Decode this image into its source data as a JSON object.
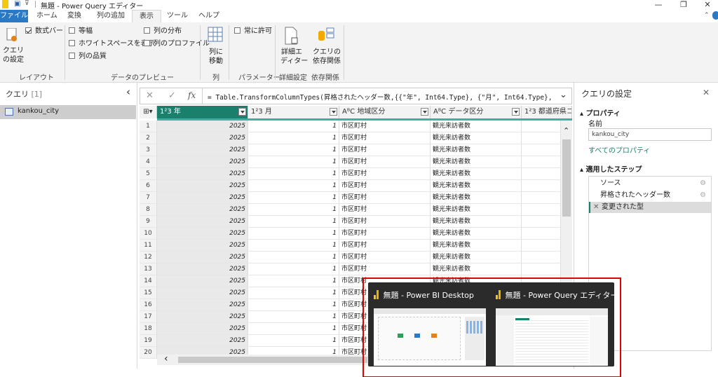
{
  "window": {
    "title": "無題 - Power Query エディター",
    "minimize_glyph": "—",
    "restore_glyph": "❐",
    "close_glyph": "✕"
  },
  "tabs": [
    "ファイル",
    "ホーム",
    "変換",
    "列の追加",
    "表示",
    "ツール",
    "ヘルプ"
  ],
  "ribbon": {
    "query_settings": "クエリ\nの設定",
    "formula_bar": "数式バー",
    "monospace": "等幅",
    "show_whitespace": "ホワイトスペースを表示",
    "column_quality": "列の品質",
    "column_distribution": "列の分布",
    "column_profile": "列のプロファイル",
    "go_to_column": "列に\n移動",
    "always_allow": "常に許可",
    "advanced_editor": "詳細エ\nディター",
    "query_dependencies": "クエリの\n依存関係",
    "groups": [
      "レイアウト",
      "データのプレビュー",
      "列",
      "パラメーター",
      "詳細設定",
      "依存関係"
    ]
  },
  "left_pane": {
    "title": "クエリ",
    "count": "[1]",
    "collapse_glyph": "‹",
    "query_name": "kankou_city"
  },
  "formula": {
    "cancel_glyph": "✕",
    "commit_glyph": "✓",
    "fx": "fx",
    "text": "= Table.TransformColumnTypes(昇格されたヘッダー数,{{\"年\", Int64.Type}, {\"月\", Int64.Type}, {\"",
    "expand_glyph": "⌄"
  },
  "grid": {
    "columns": [
      {
        "type": "1²3",
        "name": "年"
      },
      {
        "type": "1²3",
        "name": "月"
      },
      {
        "type": "AᴮC",
        "name": "地域区分"
      },
      {
        "type": "AᴮC",
        "name": "データ区分"
      },
      {
        "type": "1²3",
        "name": "都道府県コー"
      }
    ],
    "rows": [
      [
        "1",
        "2025",
        "1",
        "市区町村",
        "観光来訪者数"
      ],
      [
        "2",
        "2025",
        "1",
        "市区町村",
        "観光来訪者数"
      ],
      [
        "3",
        "2025",
        "1",
        "市区町村",
        "観光来訪者数"
      ],
      [
        "4",
        "2025",
        "1",
        "市区町村",
        "観光来訪者数"
      ],
      [
        "5",
        "2025",
        "1",
        "市区町村",
        "観光来訪者数"
      ],
      [
        "6",
        "2025",
        "1",
        "市区町村",
        "観光来訪者数"
      ],
      [
        "7",
        "2025",
        "1",
        "市区町村",
        "観光来訪者数"
      ],
      [
        "8",
        "2025",
        "1",
        "市区町村",
        "観光来訪者数"
      ],
      [
        "9",
        "2025",
        "1",
        "市区町村",
        "観光来訪者数"
      ],
      [
        "10",
        "2025",
        "1",
        "市区町村",
        "観光来訪者数"
      ],
      [
        "11",
        "2025",
        "1",
        "市区町村",
        "観光来訪者数"
      ],
      [
        "12",
        "2025",
        "1",
        "市区町村",
        "観光来訪者数"
      ],
      [
        "13",
        "2025",
        "1",
        "市区町村",
        "観光来訪者数"
      ],
      [
        "14",
        "2025",
        "1",
        "市区町村",
        "観光来訪者数"
      ],
      [
        "15",
        "2025",
        "1",
        "市区町村",
        ""
      ],
      [
        "16",
        "2025",
        "1",
        "市区町村",
        ""
      ],
      [
        "17",
        "2025",
        "1",
        "市区町村",
        ""
      ],
      [
        "18",
        "2025",
        "1",
        "市区町村",
        ""
      ],
      [
        "19",
        "2025",
        "1",
        "市区町村",
        ""
      ],
      [
        "20",
        "2025",
        "1",
        "市区町村",
        ""
      ]
    ],
    "scroll_left_glyph": "‹",
    "scroll_up_glyph": "⌃"
  },
  "right_pane": {
    "title": "クエリの設定",
    "close_glyph": "✕",
    "properties_header": "プロパティ",
    "name_label": "名前",
    "name_value": "kankou_city",
    "all_properties": "すべてのプロパティ",
    "steps_header": "適用したステップ",
    "steps": [
      "ソース",
      "昇格されたヘッダー数",
      "変更された型"
    ],
    "delete_glyph": "✕"
  },
  "taskbar_preview": {
    "items": [
      "無題 - Power BI Desktop",
      "無題 - Power Query エディター"
    ]
  },
  "colors": {
    "accent": "#2b78c5",
    "header_selected": "#1a7f6b",
    "highlight": "#e00000",
    "pbi_yellow": "#f2c811"
  }
}
